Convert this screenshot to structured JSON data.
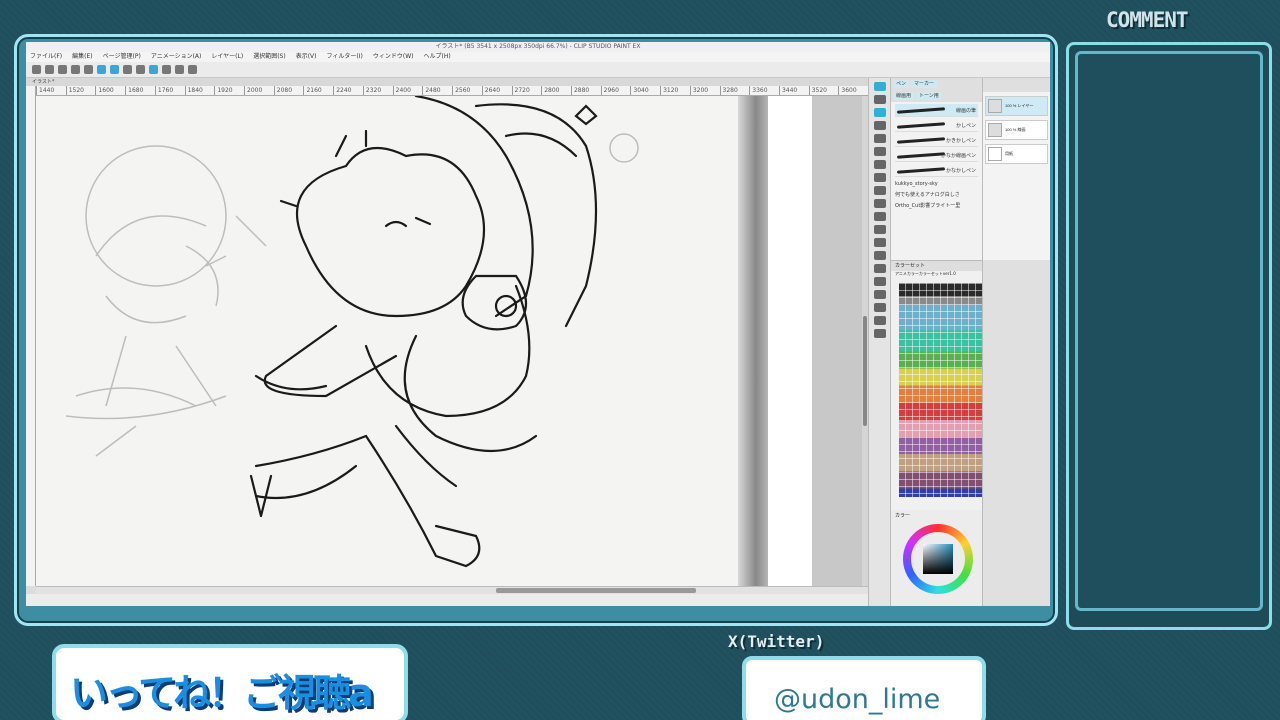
{
  "overlay": {
    "comment_title": "COMMENT",
    "ticker_text": "いってね！ご視聴a",
    "x_label": "X(Twitter)",
    "x_handle": "@udon_lime",
    "accent_color": "#8fdde9",
    "background_color": "#1f4e5d"
  },
  "app": {
    "window_title": "イラスト* (B5 3541 x 2508px 350dpi 66.7%) - CLIP STUDIO PAINT EX",
    "menu": [
      "ファイル(F)",
      "編集(E)",
      "ページ管理(P)",
      "アニメーション(A)",
      "レイヤー(L)",
      "選択範囲(S)",
      "表示(V)",
      "フィルター(I)",
      "ウィンドウ(W)",
      "ヘルプ(H)"
    ],
    "canvas_tab": "イラスト*",
    "ruler_ticks": [
      "1440",
      "1520",
      "1600",
      "1680",
      "1760",
      "1840",
      "1920",
      "2000",
      "2080",
      "2160",
      "2240",
      "2320",
      "2400",
      "2480",
      "2560",
      "2640",
      "2720",
      "2800",
      "2880",
      "2960",
      "3040",
      "3120",
      "3200",
      "3280",
      "3360",
      "3440",
      "3520",
      "3600"
    ],
    "subtool_tabs": [
      "ペン",
      "マーカー"
    ],
    "subtool_tabs_2": [
      "線画用",
      "トーン用"
    ],
    "brushes": [
      "線画の筆",
      "かしペン",
      "かきかしペン",
      "かなか線画ペン",
      "かなかしペン",
      "kukkyo_story-sky",
      "何でも使えるアナログ白しさ",
      "Ortho_Cut影響ブライト一里"
    ],
    "layers": [
      "100 % レイヤー",
      "100 % 線画",
      "用紙"
    ],
    "colorset_title": "カラーセット",
    "colorset_name": "アニメカラーカラーセットver1.0",
    "color_wheel_title": "カラー"
  }
}
